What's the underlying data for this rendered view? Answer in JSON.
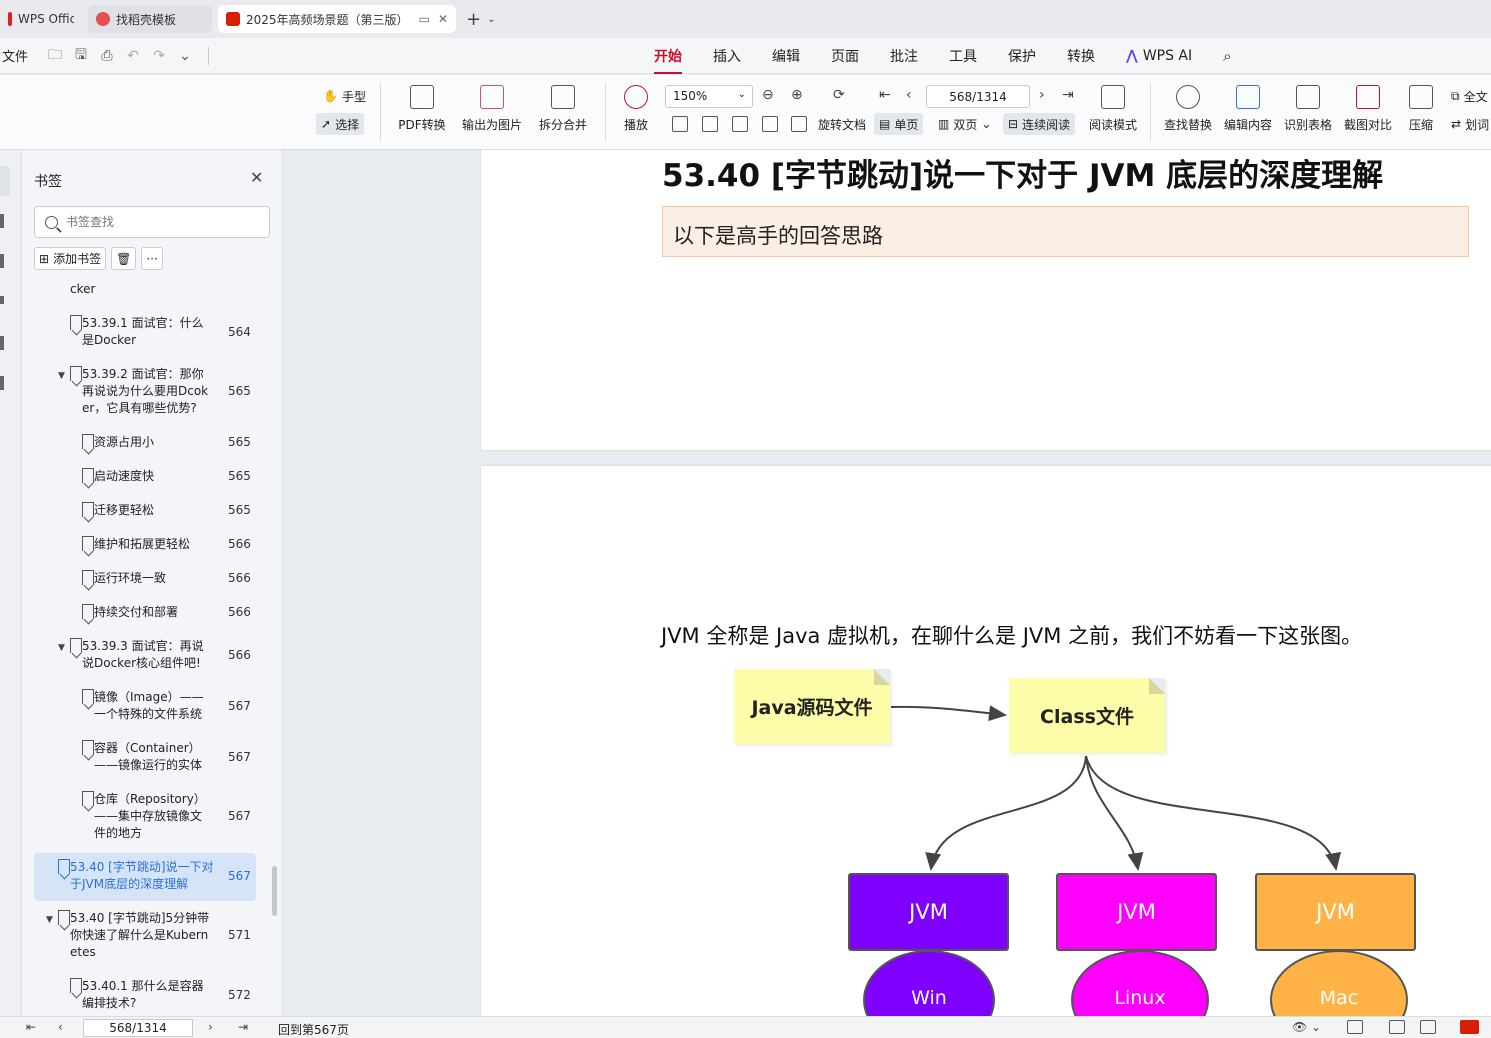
{
  "tabs": [
    {
      "label": "WPS Office",
      "color": "#e02020"
    },
    {
      "label": "找稻壳模板",
      "color": "#e55050"
    },
    {
      "label": "2025年高频场景题（第三版）",
      "color": "#d81e06"
    }
  ],
  "menu": {
    "file": "文件",
    "items": [
      "开始",
      "插入",
      "编辑",
      "页面",
      "批注",
      "工具",
      "保护",
      "转换"
    ],
    "active": "开始",
    "wps_ai": "WPS AI"
  },
  "ribbon": {
    "hand": "手型",
    "select": "选择",
    "pdf_convert": "PDF转换",
    "export_image": "输出为图片",
    "split_merge": "拆分合并",
    "play": "播放",
    "zoom": "150%",
    "page_input": "568/1314",
    "rotate": "旋转文档",
    "single": "单页",
    "double": "双页",
    "continuous": "连续阅读",
    "reading_mode": "阅读模式",
    "find_replace": "查找替换",
    "edit_content": "编辑内容",
    "recognize_table": "识别表格",
    "screenshot_compare": "截图对比",
    "compress": "压缩",
    "fulltext": "全文",
    "translate": "划词"
  },
  "bookmarks": {
    "title": "书签",
    "search_placeholder": "书签查找",
    "add_label": "添加书签",
    "items": [
      {
        "text": "cker",
        "page": ""
      },
      {
        "text": "53.39.1 面试官：什么\n是Docker",
        "page": "564"
      },
      {
        "text": "53.39.2 面试官：那你\n再说说为什么要用Dcok\ner，它具有哪些优势?",
        "page": "565"
      },
      {
        "text": "资源占用小",
        "page": "565"
      },
      {
        "text": "启动速度快",
        "page": "565"
      },
      {
        "text": "迁移更轻松",
        "page": "565"
      },
      {
        "text": "维护和拓展更轻松",
        "page": "566"
      },
      {
        "text": "运行环境一致",
        "page": "566"
      },
      {
        "text": "持续交付和部署",
        "page": "566"
      },
      {
        "text": "53.39.3 面试官：再说\n说Docker核心组件吧!",
        "page": "566"
      },
      {
        "text": "镜像（Image）——\n一个特殊的文件系统",
        "page": "567"
      },
      {
        "text": "容器（Container）\n——镜像运行的实体",
        "page": "567"
      },
      {
        "text": "仓库（Repository）\n——集中存放镜像文\n件的地方",
        "page": "567"
      },
      {
        "text": "53.40 [字节跳动]说一下对\n于JVM底层的深度理解",
        "page": "567"
      },
      {
        "text": "53.40 [字节跳动]5分钟带\n你快速了解什么是Kubern\netes",
        "page": "571"
      },
      {
        "text": "53.40.1 那什么是容器\n编排技术?",
        "page": "572"
      }
    ]
  },
  "document": {
    "heading": "53.40 [字节跳动]说一下对于 JVM 底层的深度理解",
    "quote": "以下是高手的回答思路",
    "paragraph": "JVM 全称是 Java 虚拟机，在聊什么是 JVM 之前，我们不妨看一下这张图。",
    "diagram": {
      "source": "Java源码文件",
      "class": "Class文件",
      "jvm_label": "JVM",
      "os": [
        "Win",
        "Linux",
        "Mac"
      ],
      "colors": [
        "#7f00ff",
        "#ff00ff",
        "#ffb347"
      ]
    }
  },
  "status": {
    "page": "568/1314",
    "back": "回到第567页"
  }
}
